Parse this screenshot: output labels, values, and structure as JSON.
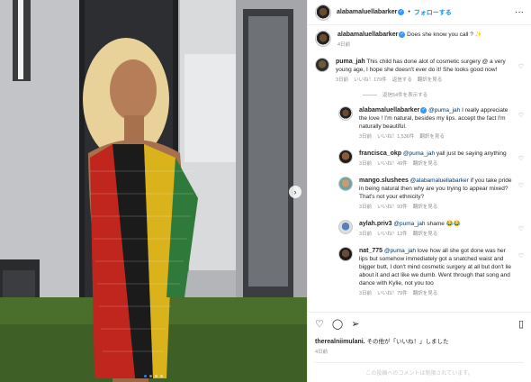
{
  "header": {
    "username": "alabamaluellabarker",
    "follow_label": "フォローする",
    "dot": "•",
    "more": "···"
  },
  "photo": {
    "next": "›"
  },
  "comments": [
    {
      "user": "alabamaluellabarker",
      "verified": true,
      "text": "Does she know you call ? ✨",
      "time": "4日前"
    },
    {
      "user": "puma_jah",
      "text": "This child has done alot of cosmetic surgery @ a very young age, I hope she doesn't ever do it! She looks good now!",
      "time": "3日前",
      "likes": "いいね！179件",
      "reply": "返信する",
      "translate": "翻訳を見る",
      "toggle": "返信54件を表示する"
    }
  ],
  "replies": [
    {
      "user": "alabamaluellabarker",
      "mention": "@puma_jah",
      "text": " I really appreciate the love ! I'm natural, besides my lips. accept the fact I'm naturally beautiful.",
      "time": "3日前",
      "likes": "いいね！1,536件",
      "translate": "翻訳を見る"
    },
    {
      "user": "francisca_okp",
      "mention": "@puma_jah",
      "text": " yall just be saying anything",
      "time": "3日前",
      "likes": "いいね！49件",
      "translate": "翻訳を見る"
    },
    {
      "user": "mango.slushees",
      "mention": "@alabamaluellabarker",
      "text": " if you take pride in being natural then why are you trying to appear mixed? That's not your ethnicity?",
      "time": "3日前",
      "likes": "いいね！93件",
      "translate": "翻訳を見る"
    },
    {
      "user": "aylah.priv3",
      "mention": "@puma_jah",
      "text": " shame 😂😂",
      "time": "3日前",
      "likes": "いいね！13件",
      "translate": "翻訳を見る"
    },
    {
      "user": "nat_775",
      "mention": "@puma_jah",
      "text": " love how all she got done was her lips but somehow immediately got a snatched waist and bigger butt, I don't mind cosmetic surgery at all but don't lie about it and act like we dumb. Went through that song and dance with Kylie, not you too",
      "time": "3日前",
      "likes": "いいね！79件",
      "translate": "翻訳を見る"
    }
  ],
  "actions": {
    "like_icon": "heart-icon",
    "comment_icon": "comment-icon",
    "share_icon": "share-icon",
    "save_icon": "bookmark-icon",
    "liked_by_user": "therealniimulani.",
    "liked_by_rest": "その他が「いいね！」しました",
    "date": "4日前",
    "add_comment_placeholder": "この投稿へのコメントは制限されています。"
  }
}
